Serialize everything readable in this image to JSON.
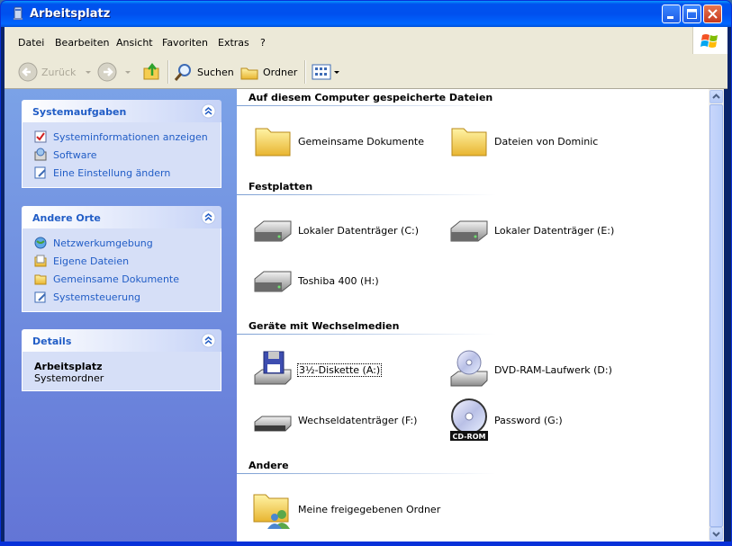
{
  "window": {
    "title": "Arbeitsplatz"
  },
  "menu": [
    "Datei",
    "Bearbeiten",
    "Ansicht",
    "Favoriten",
    "Extras",
    "?"
  ],
  "toolbar": {
    "back_label": "Zurück",
    "search_label": "Suchen",
    "folders_label": "Ordner"
  },
  "sidebar": {
    "system_tasks": {
      "title": "Systemaufgaben",
      "items": [
        {
          "label": "Systeminformationen anzeigen",
          "icon": "system-info-icon"
        },
        {
          "label": "Software",
          "icon": "software-icon"
        },
        {
          "label": "Eine Einstellung ändern",
          "icon": "settings-icon"
        }
      ]
    },
    "other_places": {
      "title": "Andere Orte",
      "items": [
        {
          "label": "Netzwerkumgebung",
          "icon": "network-icon"
        },
        {
          "label": "Eigene Dateien",
          "icon": "my-documents-icon"
        },
        {
          "label": "Gemeinsame Dokumente",
          "icon": "folder-icon"
        },
        {
          "label": "Systemsteuerung",
          "icon": "control-panel-icon"
        }
      ]
    },
    "details": {
      "title": "Details",
      "name": "Arbeitsplatz",
      "type": "Systemordner"
    }
  },
  "groups": {
    "stored": {
      "title": "Auf diesem Computer gespeicherte Dateien",
      "items": [
        "Gemeinsame Dokumente",
        "Dateien von Dominic"
      ]
    },
    "drives": {
      "title": "Festplatten",
      "items": [
        "Lokaler Datenträger (C:)",
        "Lokaler Datenträger (E:)",
        "Toshiba 400 (H:)"
      ]
    },
    "removable": {
      "title": "Geräte mit Wechselmedien",
      "items": [
        "3½-Diskette (A:)",
        "DVD-RAM-Laufwerk (D:)",
        "Wechseldatenträger (F:)",
        "Password (G:)"
      ],
      "cdrom_badge": "CD-ROM"
    },
    "other": {
      "title": "Andere",
      "items": [
        "Meine freigegebenen Ordner"
      ]
    }
  },
  "colors": {
    "title_bar": "#0054e3",
    "sidebar_link": "#215dc6",
    "sidebar_bg": "#6f8fe0"
  }
}
